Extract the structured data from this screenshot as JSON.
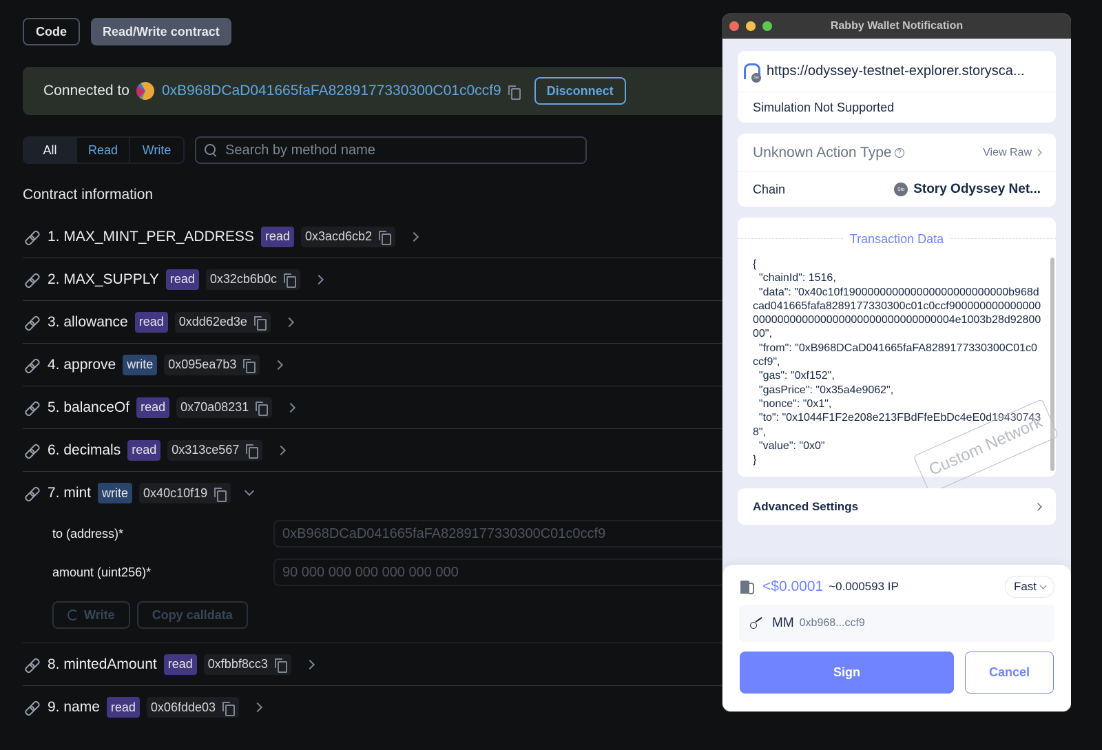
{
  "explorer": {
    "tabs": [
      {
        "label": "Code",
        "active": false
      },
      {
        "label": "Read/Write contract",
        "active": true
      }
    ],
    "connection": {
      "label": "Connected to",
      "address": "0xB968DCaD041665faFA8289177330300C01c0ccf9",
      "disconnect_label": "Disconnect"
    },
    "filter": [
      {
        "label": "All",
        "active": true
      },
      {
        "label": "Read",
        "active": false
      },
      {
        "label": "Write",
        "active": false
      }
    ],
    "search": {
      "placeholder": "Search by method name",
      "value": ""
    },
    "section_title": "Contract information",
    "methods": [
      {
        "name": "1. MAX_MINT_PER_ADDRESS",
        "type": "read",
        "selector": "0x3acd6cb2",
        "expanded": false
      },
      {
        "name": "2. MAX_SUPPLY",
        "type": "read",
        "selector": "0x32cb6b0c",
        "expanded": false
      },
      {
        "name": "3. allowance",
        "type": "read",
        "selector": "0xdd62ed3e",
        "expanded": false
      },
      {
        "name": "4. approve",
        "type": "write",
        "selector": "0x095ea7b3",
        "expanded": false
      },
      {
        "name": "5. balanceOf",
        "type": "read",
        "selector": "0x70a08231",
        "expanded": false
      },
      {
        "name": "6. decimals",
        "type": "read",
        "selector": "0x313ce567",
        "expanded": false
      },
      {
        "name": "7. mint",
        "type": "write",
        "selector": "0x40c10f19",
        "expanded": true
      },
      {
        "name": "8. mintedAmount",
        "type": "read",
        "selector": "0xfbbf8cc3",
        "expanded": false
      },
      {
        "name": "9. name",
        "type": "read",
        "selector": "0x06fdde03",
        "expanded": false
      }
    ],
    "mint_form": {
      "fields": [
        {
          "label": "to (address)*",
          "value": "0xB968DCaD041665faFA8289177330300C01c0ccf9"
        },
        {
          "label": "amount (uint256)*",
          "value": "90 000 000 000 000 000 000"
        }
      ],
      "write_label": "Write",
      "copy_calldata_label": "Copy calldata"
    }
  },
  "wallet": {
    "window_title": "Rabby Wallet Notification",
    "site_url": "https://odyssey-testnet-explorer.storysca...",
    "site_badge": "Sto",
    "simulation_status": "Simulation Not Supported",
    "action_type": "Unknown Action Type",
    "view_raw_label": "View Raw",
    "chain_label": "Chain",
    "chain_badge": "Sto",
    "chain_value": "Story Odyssey Net...",
    "tx_title": "Transaction Data",
    "tx_json": "{\n  \"chainId\": 1516,\n  \"data\": \"0x40c10f190000000000000000000000000b968dcad041665fafa8289177330300c01c0ccf900000000000000000000000000000000000000000000004e1003b28d9280000\",\n  \"from\": \"0xB968DCaD041665faFA8289177330300C01c0ccf9\",\n  \"gas\": \"0xf152\",\n  \"gasPrice\": \"0x35a4e9062\",\n  \"nonce\": \"0x1\",\n  \"to\": \"0x1044F1F2e208e213FBdFfeEbDc4eE0d194307438\",\n  \"value\": \"0x0\"\n}",
    "watermark": "Custom Network",
    "advanced_settings_label": "Advanced Settings",
    "gas": {
      "usd": "<$0.0001",
      "native": "~0.000593 IP",
      "speed": "Fast"
    },
    "account": {
      "name": "MM",
      "address": "0xb968...ccf9"
    },
    "sign_label": "Sign",
    "cancel_label": "Cancel"
  },
  "colors": {
    "accent_blue": "#62a6e0",
    "read_badge": "#433781",
    "write_badge": "#2a446b",
    "rabby_primary": "#7084ff"
  }
}
